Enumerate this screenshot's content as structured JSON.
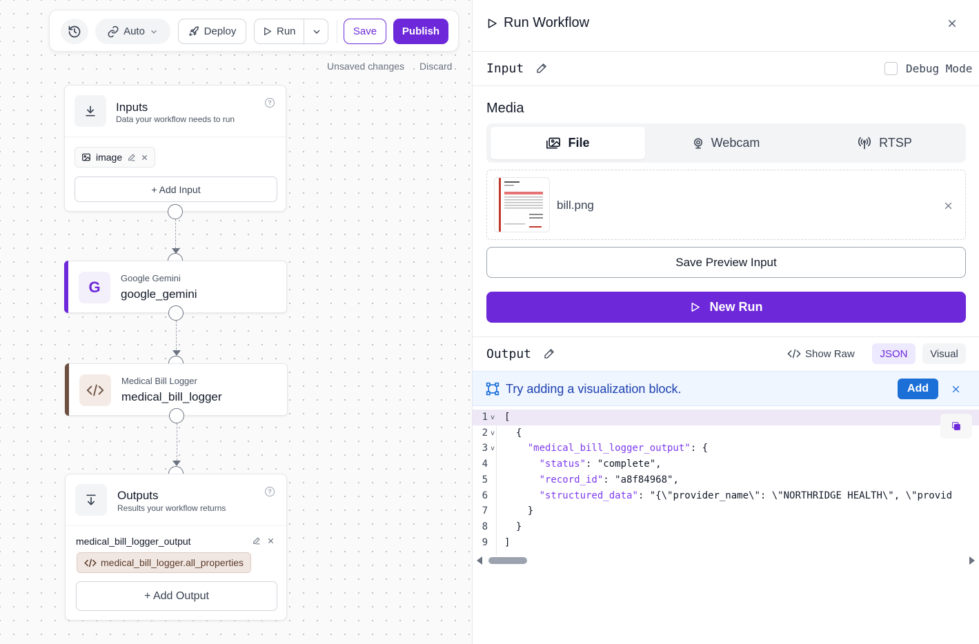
{
  "toolbar": {
    "history_icon": "history-icon",
    "auto_label": "Auto",
    "deploy_label": "Deploy",
    "run_label": "Run",
    "save_label": "Save",
    "publish_label": "Publish",
    "unsaved_text": "Unsaved changes",
    "discard_label": "Discard"
  },
  "canvas": {
    "inputs_node": {
      "title": "Inputs",
      "subtitle": "Data your workflow needs to run",
      "input_chip": "image",
      "add_input_label": "+ Add Input"
    },
    "gemini_node": {
      "type": "Google Gemini",
      "name": "google_gemini",
      "accent": "#6d28d9"
    },
    "logger_node": {
      "type": "Medical Bill Logger",
      "name": "medical_bill_logger",
      "accent": "#6b4f3f"
    },
    "outputs_node": {
      "title": "Outputs",
      "subtitle": "Results your workflow returns",
      "output_name": "medical_bill_logger_output",
      "output_ref": "medical_bill_logger.all_properties",
      "add_output_label": "+ Add Output"
    }
  },
  "panel": {
    "title": "Run Workflow",
    "input_label": "Input",
    "debug_label": "Debug Mode",
    "media_label": "Media",
    "tabs": [
      {
        "label": "File",
        "icon": "images-icon",
        "active": true
      },
      {
        "label": "Webcam",
        "icon": "webcam-icon",
        "active": false
      },
      {
        "label": "RTSP",
        "icon": "antenna-icon",
        "active": false
      }
    ],
    "file_name": "bill.png",
    "save_preview_label": "Save Preview Input",
    "new_run_label": "New Run",
    "output_label": "Output",
    "show_raw_label": "Show Raw",
    "json_label": "JSON",
    "visual_label": "Visual",
    "viz_banner_text": "Try adding a visualization block.",
    "viz_add_label": "Add",
    "code_lines": [
      {
        "n": "1",
        "fold": true,
        "indent": "",
        "text": "["
      },
      {
        "n": "2",
        "fold": true,
        "indent": "  ",
        "text": "{"
      },
      {
        "n": "3",
        "fold": true,
        "indent": "    ",
        "key": "\"medical_bill_logger_output\"",
        "text": ": {"
      },
      {
        "n": "4",
        "fold": false,
        "indent": "      ",
        "key": "\"status\"",
        "text": ": \"complete\","
      },
      {
        "n": "5",
        "fold": false,
        "indent": "      ",
        "key": "\"record_id\"",
        "text": ": \"a8f84968\","
      },
      {
        "n": "6",
        "fold": false,
        "indent": "      ",
        "key": "\"structured_data\"",
        "text": ": \"{\\\"provider_name\\\": \\\"NORTHRIDGE HEALTH\\\", \\\"provid"
      },
      {
        "n": "7",
        "fold": false,
        "indent": "    ",
        "text": "}"
      },
      {
        "n": "8",
        "fold": false,
        "indent": "  ",
        "text": "}"
      },
      {
        "n": "9",
        "fold": false,
        "indent": "",
        "text": "]"
      }
    ]
  }
}
